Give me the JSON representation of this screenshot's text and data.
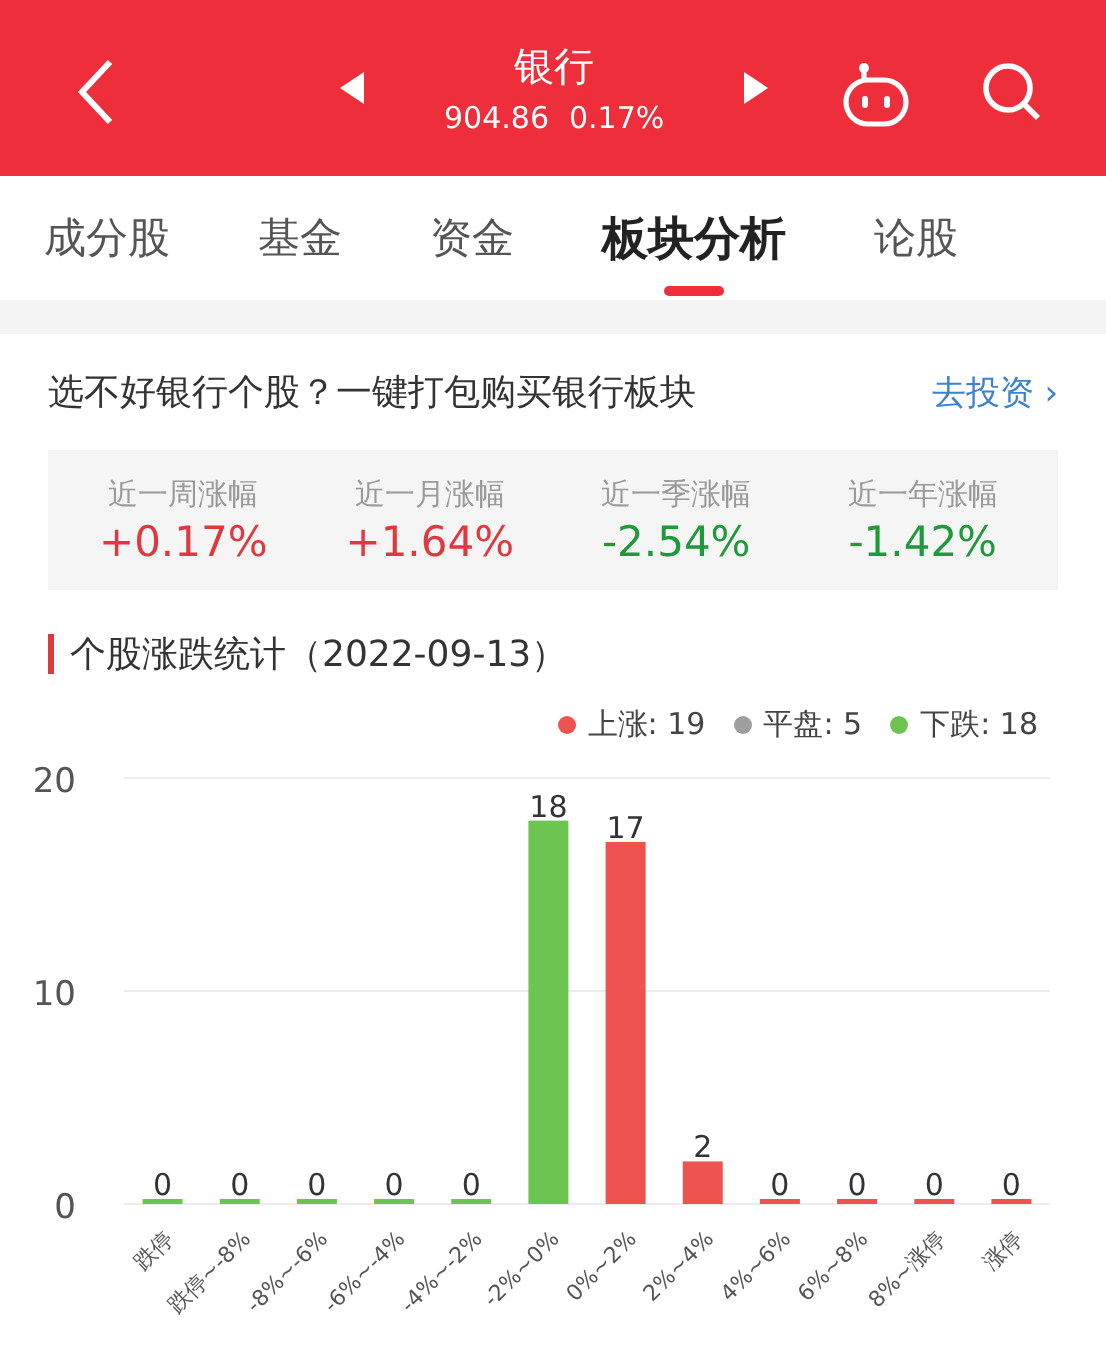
{
  "header": {
    "title": "银行",
    "price": "904.86",
    "change": "0.17%"
  },
  "tabs": [
    {
      "label": "成分股",
      "selected": false
    },
    {
      "label": "基金",
      "selected": false
    },
    {
      "label": "资金",
      "selected": false
    },
    {
      "label": "板块分析",
      "selected": true
    },
    {
      "label": "论股",
      "selected": false
    }
  ],
  "promo": {
    "text": "选不好银行个股？一键打包购买银行板块",
    "link": "去投资",
    "link_icon": "›"
  },
  "stats": [
    {
      "label": "近一周涨幅",
      "value": "+0.17%",
      "color": "#e0383e"
    },
    {
      "label": "近一月涨幅",
      "value": "+1.64%",
      "color": "#e0383e"
    },
    {
      "label": "近一季涨幅",
      "value": "-2.54%",
      "color": "#1f9a3a"
    },
    {
      "label": "近一年涨幅",
      "value": "-1.42%",
      "color": "#1f9a3a"
    }
  ],
  "section": {
    "title": "个股涨跌统计（2022-09-13）",
    "legend": [
      {
        "label": "上涨: 19",
        "color": "#ef5350"
      },
      {
        "label": "平盘: 5",
        "color": "#9e9e9e"
      },
      {
        "label": "下跌: 18",
        "color": "#6cc551"
      }
    ],
    "chart_data": {
      "type": "bar",
      "categories": [
        "跌停",
        "跌停~-8%",
        "-8%~-6%",
        "-6%~-4%",
        "-4%~-2%",
        "-2%~0%",
        "0%~2%",
        "2%~4%",
        "4%~6%",
        "6%~8%",
        "8%~涨停",
        "涨停"
      ],
      "series": [
        {
          "color": "#6cc551",
          "values": [
            0,
            0,
            0,
            0,
            0,
            18,
            null,
            null,
            null,
            null,
            null,
            null
          ]
        },
        {
          "color": "#ef5350",
          "values": [
            null,
            null,
            null,
            null,
            null,
            null,
            17,
            2,
            0,
            0,
            0,
            0
          ]
        }
      ],
      "ylim": [
        0,
        20
      ],
      "yticks": [
        0,
        10,
        20
      ],
      "data_labels": true
    }
  }
}
